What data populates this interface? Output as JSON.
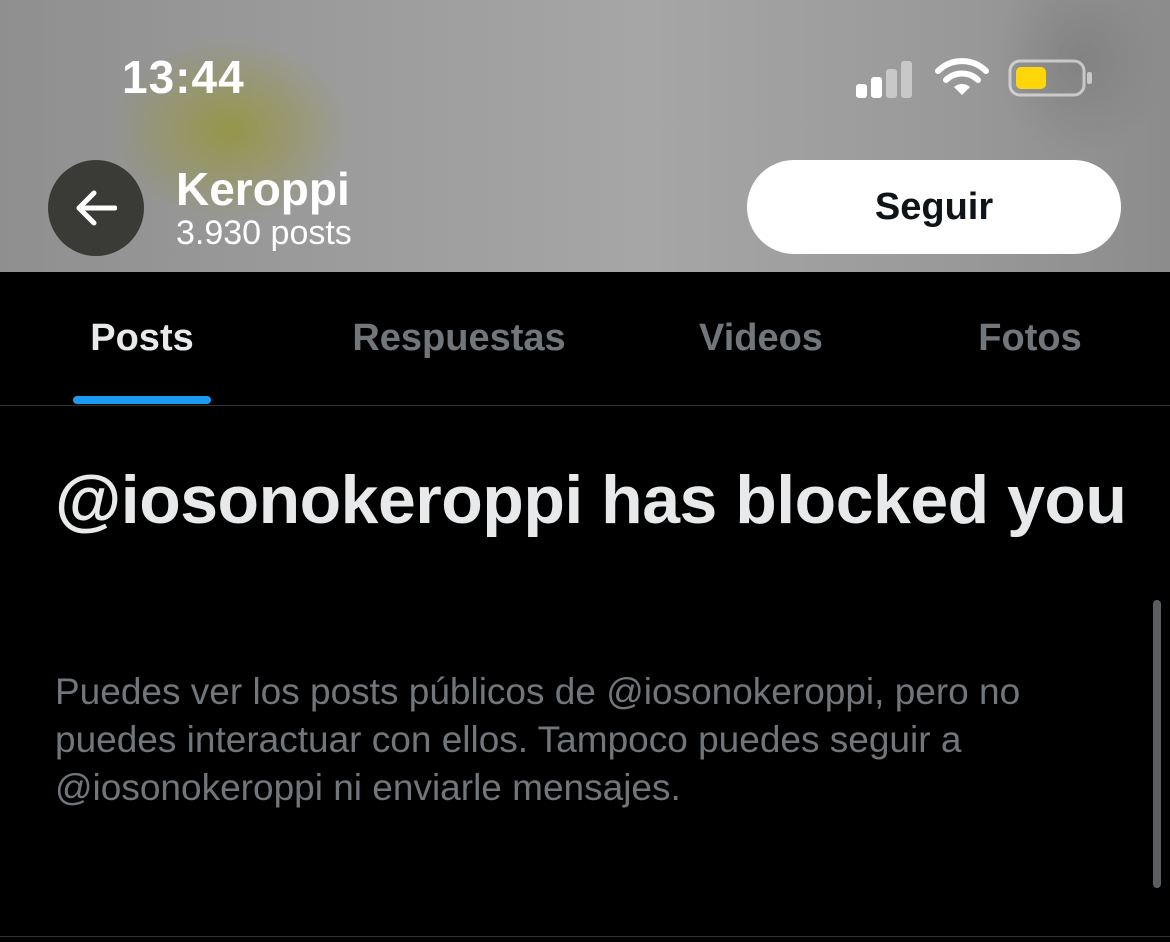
{
  "status_bar": {
    "time": "13:44"
  },
  "profile_header": {
    "name": "Keroppi",
    "posts_count": "3.930 posts",
    "follow_label": "Seguir"
  },
  "tabs": [
    {
      "label": "Posts",
      "active": true
    },
    {
      "label": "Respuestas",
      "active": false
    },
    {
      "label": "Videos",
      "active": false
    },
    {
      "label": "Fotos",
      "active": false
    }
  ],
  "blocked_notice": {
    "title": "@iosonokeroppi has blocked you",
    "description": "Puedes ver los posts públicos de @iosonokeroppi, pero no puedes interactuar con ellos. Tampoco puedes seguir a @iosonokeroppi ni enviarle mensajes."
  },
  "icons": [
    "signal-icon",
    "wifi-icon",
    "battery-icon",
    "back-arrow-icon"
  ],
  "colors": {
    "accent": "#1d9bf0",
    "battery": "#ffd60a",
    "background": "#000000",
    "muted_text": "#71767b"
  }
}
